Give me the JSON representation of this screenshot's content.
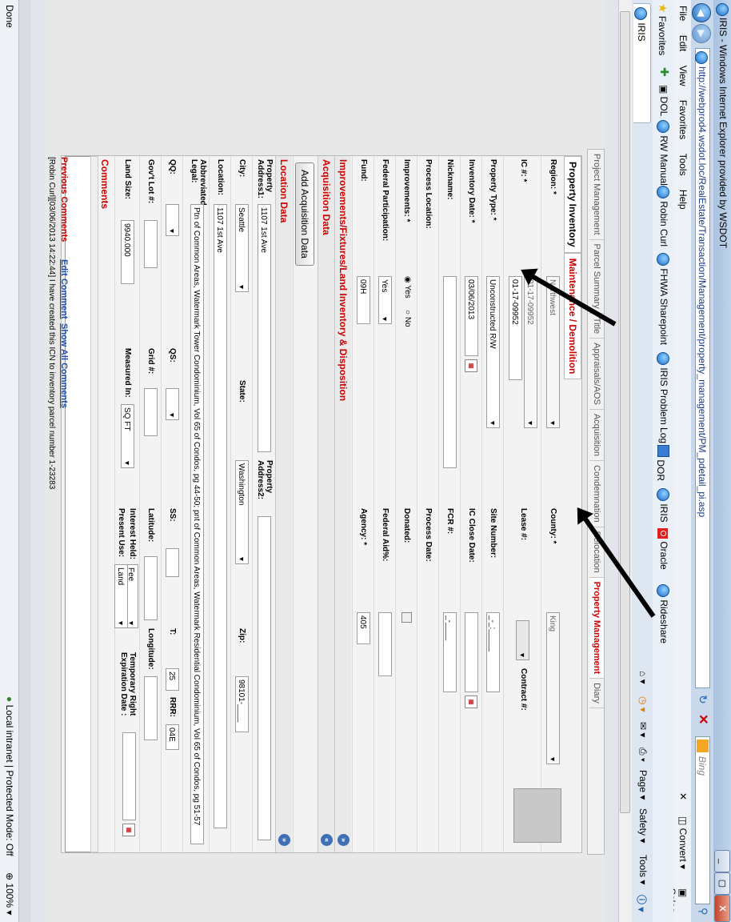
{
  "window": {
    "title": "IRIS - Windows Internet Explorer provided by WSDOT",
    "min_label": "_",
    "max_label": "▢",
    "close_label": "X"
  },
  "address": {
    "url": "http://webprod4.wsdot.loc/RealEstate/Transaction/Management/property_management/PM_pdetail_pi.asp",
    "search_placeholder": "Bing"
  },
  "menu": {
    "items": [
      "File",
      "Edit",
      "View",
      "Favorites",
      "Tools",
      "Help"
    ],
    "convert": "Convert",
    "select": "Selec"
  },
  "favorites": {
    "label": "Favorites",
    "links": [
      "DOL",
      "RW Manual",
      "Robin Curl",
      "FHWA Sharepoint",
      "IRIS Problem Log",
      "DOR",
      "IRIS",
      "Oracle",
      "Rideshare"
    ]
  },
  "tabbar": {
    "tab_label": "IRIS",
    "commands": [
      "Page ▾",
      "Safety ▾",
      "Tools ▾"
    ]
  },
  "app": {
    "tabs": [
      "Project Management",
      "Parcel Summary",
      "Title",
      "Appraisals/AOS",
      "Acquisition",
      "Condemnation",
      "Relocation",
      "Property Management",
      "Diary"
    ],
    "active_tab": "Property Management",
    "subtabs": [
      "Property Inventory",
      "Maintenance / Demolition"
    ],
    "fields": {
      "region_label": "Region: *",
      "region": "Northwest",
      "county_label": "County: *",
      "county": "King",
      "ic_label": "IC #: *",
      "ic1": "01-17-09952",
      "ic2": "01-17-09952",
      "lease_label": "Lease #:",
      "contract_label": "Contract #:",
      "property_type_label": "Property Type: *",
      "property_type": "Unconstructed R/W",
      "site_number_label": "Site Number:",
      "site_number": "_-_:_____",
      "inventory_date_label": "Inventory Date: *",
      "inventory_date": "03/06/2013",
      "ic_close_label": "IC Close Date:",
      "nickname_label": "Nickname:",
      "fcr_label": "FCR #:",
      "fcr": "_-____",
      "process_location_label": "Process Location:",
      "process_date_label": "Process Date:",
      "improvements_label": "Improvements: *",
      "yes": "Yes",
      "no": "No",
      "donated_label": "Donated:",
      "federal_participation_label": "Federal Participation:",
      "federal_participation": "Yes",
      "federal_aid_label": "Federal Aid%:",
      "fund_label": "Fund:",
      "fund": "09H",
      "agency_label": "Agency: *",
      "agency": "405"
    },
    "sections": {
      "improvements": "Improvements/Fixtures/Land Inventory & Disposition",
      "acquisition": "Acquisition Data",
      "add_acquisition_button": "Add Acquisition Data",
      "location": "Location Data",
      "comments": "Comments"
    },
    "location": {
      "address1_label": "Property Address1:",
      "address1": "1107 1st Ave",
      "address2_label": "Property Address2:",
      "city_label": "City:",
      "city": "Seattle",
      "state_label": "State:",
      "state": "Washington",
      "zip_label": "Zip:",
      "zip": "98101-____",
      "location_label": "Location:",
      "location": "1107 1st Ave",
      "legal_label": "Abbreviated Legal:",
      "legal": "Ptn of Common Areas, Watermark Tower Condominium, Vol 65 of Condos, pg 44-50; pnt of Common Areas, Watermark Residential Condominium, Vol 65 of Condos, pg 51-57",
      "qq_label": "QQ:",
      "qs_label": "QS:",
      "ss_label": "SS:",
      "t_label": "T:",
      "t": "25",
      "rrr_label": "RRR:",
      "rrr": "04E",
      "govlot_label": "Gov't Lot #:",
      "grid_label": "Grid #:",
      "latitude_label": "Latitude:",
      "longitude_label": "Longitude:",
      "land_size_label": "Land Size:",
      "land_size": "9940.000",
      "measured_label": "Measured In:",
      "measured": "SQ FT",
      "interest_label": "Interest Held:",
      "interest": "Fee",
      "temp_right_label": "Temporary Right Expiration Date :",
      "present_use_label": "Present Use:",
      "present_use": "Land"
    },
    "previous_comments": {
      "label": "Previous Comments",
      "edit": "Edit Comment",
      "show_all": "Show All Comments",
      "text": "[Robin Curl][03/06/2013 14:22:44]  I have created this ICN to inventory parcel number 1-23283"
    }
  },
  "status": {
    "left": "Done",
    "zone": "Local intranet | Protected Mode: Off",
    "zoom": "100%"
  }
}
